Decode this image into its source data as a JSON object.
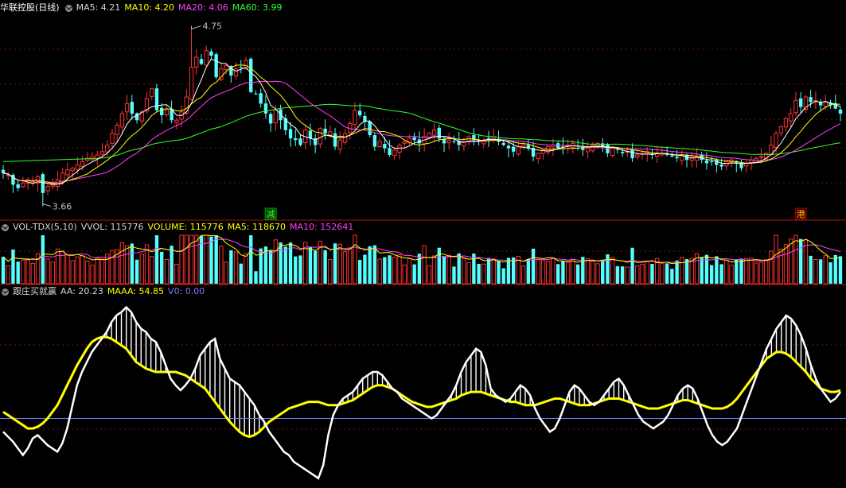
{
  "colors": {
    "up": "#ff3232",
    "down": "#54ffff",
    "ma5": "#ffffff",
    "ma10": "#ffff00",
    "ma20": "#ff40ff",
    "ma60": "#30ff30",
    "grid": "#7a1010",
    "aa": "#ffffff",
    "maaa": "#ffff00",
    "v0": "#7a7aff"
  },
  "price_panel": {
    "title": "华联控股(日线)",
    "ma5": "MA5: 4.21",
    "ma10": "MA10: 4.20",
    "ma20": "MA20: 4.06",
    "ma60": "MA60: 3.99",
    "high_label": "4.75",
    "low_label": "3.66",
    "marker_jian": "减",
    "marker_gang": "港"
  },
  "volume_panel": {
    "title": "VOL-TDX(5,10)",
    "vvol": "VVOL: 115776",
    "volume": "VOLUME: 115776",
    "ma5": "MA5: 118670",
    "ma10": "MA10: 152641"
  },
  "indicator_panel": {
    "title": "跟庄买就赢",
    "aa": "AA: 20.23",
    "maaa": "MAAA: 54.85",
    "v0": "V0: 0.00"
  },
  "chart_data": [
    {
      "type": "candlestick",
      "title": "华联控股(日线)",
      "ylim": [
        3.6,
        4.82
      ],
      "annotations": [
        {
          "label": "4.75",
          "x_index": 38,
          "y": 4.75
        },
        {
          "label": "3.66",
          "x_index": 8,
          "y": 3.66
        },
        {
          "label": "减",
          "x_index": 54
        },
        {
          "label": "港",
          "x_index": 161
        }
      ],
      "close": [
        3.86,
        3.85,
        3.79,
        3.77,
        3.8,
        3.82,
        3.81,
        3.84,
        3.74,
        3.78,
        3.79,
        3.82,
        3.86,
        3.88,
        3.89,
        3.91,
        3.93,
        3.95,
        3.96,
        3.97,
        3.99,
        4.03,
        4.1,
        4.15,
        4.22,
        4.28,
        4.22,
        4.18,
        4.23,
        4.31,
        4.37,
        4.24,
        4.21,
        4.24,
        4.18,
        4.18,
        4.23,
        4.32,
        4.5,
        4.56,
        4.52,
        4.6,
        4.57,
        4.44,
        4.49,
        4.51,
        4.45,
        4.49,
        4.5,
        4.54,
        4.35,
        4.34,
        4.28,
        4.22,
        4.16,
        4.24,
        4.18,
        4.12,
        4.07,
        4.06,
        4.03,
        4.12,
        4.07,
        4.03,
        4.13,
        4.1,
        4.11,
        4.02,
        4.06,
        4.1,
        4.16,
        4.24,
        4.21,
        4.17,
        4.09,
        4.02,
        4.05,
        4.01,
        3.97,
        4.0,
        4.03,
        4.05,
        4.07,
        4.06,
        4.04,
        4.08,
        4.1,
        4.12,
        4.07,
        4.04,
        4.06,
        4.05,
        4.03,
        4.05,
        4.08,
        4.06,
        4.05,
        4.06,
        4.07,
        4.08,
        4.05,
        4.03,
        4.01,
        3.99,
        4.02,
        4.03,
        4.01,
        3.96,
        3.98,
        4.0,
        4.02,
        4.03,
        4.01,
        4.02,
        4.03,
        4.04,
        4.02,
        4.0,
        4.01,
        4.03,
        4.04,
        4.02,
        3.98,
        4.01,
        4.0,
        3.98,
        3.99,
        3.95,
        3.97,
        3.98,
        3.99,
        3.97,
        3.98,
        3.98,
        3.97,
        3.96,
        3.95,
        3.97,
        3.94,
        3.95,
        3.96,
        3.94,
        3.92,
        3.93,
        3.91,
        3.9,
        3.93,
        3.94,
        3.92,
        3.89,
        3.92,
        3.94,
        3.95,
        3.96,
        3.98,
        4.03,
        4.1,
        4.14,
        4.19,
        4.22,
        4.3,
        4.26,
        4.32,
        4.29,
        4.3,
        4.27,
        4.29,
        4.27,
        4.25,
        4.22
      ]
    },
    {
      "type": "bar",
      "title": "VOL-TDX(5,10)",
      "series": [
        {
          "name": "VVOL",
          "values_relative": "bars scaled to panel maximum"
        },
        {
          "name": "MA5",
          "last": 118670
        },
        {
          "name": "MA10",
          "last": 152641
        }
      ],
      "last_volume": 115776
    },
    {
      "type": "line",
      "title": "跟庄买就赢",
      "ylim": [
        0,
        110
      ],
      "series": [
        {
          "name": "AA",
          "last": 20.23
        },
        {
          "name": "MAAA",
          "last": 54.85
        },
        {
          "name": "V0",
          "last": 0.0
        }
      ],
      "aa": [
        30,
        27,
        24,
        20,
        16,
        20,
        26,
        28,
        25,
        22,
        20,
        18,
        23,
        32,
        45,
        58,
        66,
        72,
        78,
        82,
        86,
        90,
        96,
        100,
        102,
        105,
        102,
        96,
        92,
        90,
        86,
        84,
        78,
        70,
        62,
        58,
        55,
        58,
        62,
        68,
        76,
        80,
        84,
        86,
        74,
        68,
        62,
        60,
        58,
        54,
        50,
        46,
        40,
        36,
        30,
        26,
        22,
        18,
        16,
        12,
        10,
        8,
        6,
        4,
        2,
        10,
        28,
        40,
        46,
        50,
        52,
        54,
        58,
        62,
        64,
        66,
        66,
        64,
        60,
        56,
        54,
        50,
        48,
        46,
        44,
        42,
        40,
        38,
        40,
        44,
        48,
        52,
        58,
        66,
        72,
        76,
        80,
        78,
        70,
        56,
        52,
        50,
        48,
        50,
        54,
        58,
        56,
        52,
        44,
        38,
        34,
        30,
        32,
        38,
        46,
        54,
        58,
        56,
        52,
        48,
        46,
        48,
        52,
        56,
        60,
        62,
        58,
        52,
        46,
        40,
        36,
        34,
        32,
        34,
        36,
        40,
        46,
        52,
        56,
        58,
        56,
        50,
        42,
        34,
        28,
        24,
        22,
        24,
        28,
        32,
        40,
        48,
        56,
        64,
        72,
        80,
        86,
        92,
        96,
        100,
        98,
        94,
        88,
        80,
        70,
        62,
        56,
        52,
        48,
        50,
        54
      ],
      "maaa": [
        42,
        40,
        38,
        36,
        34,
        32,
        32,
        33,
        35,
        38,
        42,
        46,
        52,
        58,
        64,
        70,
        75,
        80,
        84,
        86,
        87,
        87,
        86,
        84,
        82,
        80,
        76,
        72,
        70,
        68,
        67,
        66,
        66,
        66,
        66,
        66,
        65,
        64,
        62,
        60,
        58,
        56,
        52,
        48,
        44,
        40,
        36,
        33,
        30,
        28,
        27,
        28,
        30,
        33,
        36,
        38,
        40,
        42,
        44,
        45,
        46,
        47,
        48,
        48,
        48,
        47,
        46,
        46,
        46,
        47,
        48,
        49,
        51,
        53,
        55,
        57,
        58,
        58,
        57,
        56,
        54,
        52,
        50,
        48,
        47,
        46,
        45,
        45,
        46,
        47,
        48,
        49,
        50,
        52,
        53,
        54,
        54,
        54,
        53,
        52,
        51,
        50,
        49,
        48,
        48,
        47,
        46,
        46,
        46,
        47,
        48,
        49,
        50,
        50,
        49,
        48,
        47,
        46,
        46,
        46,
        47,
        48,
        49,
        50,
        50,
        50,
        49,
        48,
        47,
        46,
        45,
        44,
        44,
        44,
        45,
        46,
        47,
        48,
        49,
        49,
        48,
        47,
        46,
        45,
        44,
        44,
        44,
        45,
        47,
        50,
        54,
        58,
        62,
        66,
        70,
        74,
        76,
        78,
        78,
        77,
        75,
        72,
        69,
        66,
        62,
        59,
        56,
        55,
        54,
        54,
        55
      ]
    }
  ]
}
